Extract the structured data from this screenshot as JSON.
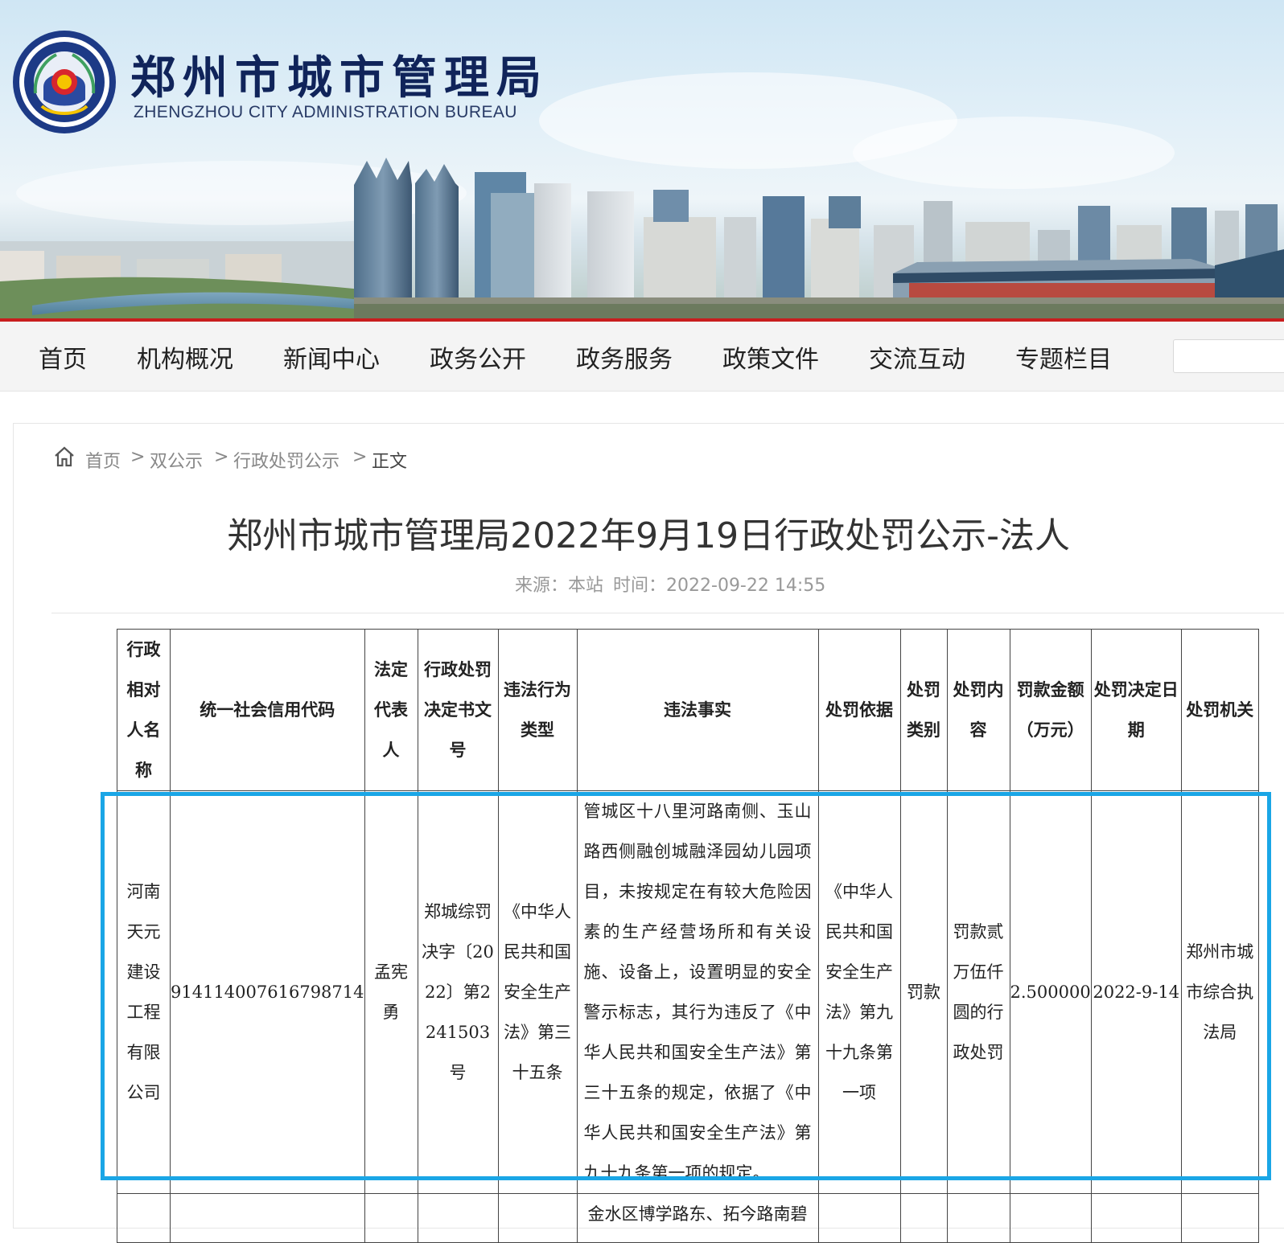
{
  "header": {
    "title": "郑州市城市管理局",
    "subtitle": "ZHENGZHOU CITY ADMINISTRATION BUREAU"
  },
  "nav": {
    "items": [
      "首页",
      "机构概况",
      "新闻中心",
      "政务公开",
      "政务服务",
      "政策文件",
      "交流互动",
      "专题栏目"
    ],
    "search_placeholder": ""
  },
  "breadcrumb": {
    "items": [
      "首页",
      "双公示",
      "行政处罚公示",
      "正文"
    ],
    "separator": ">"
  },
  "article": {
    "title": "郑州市城市管理局2022年9月19日行政处罚公示-法人",
    "source": "来源：本站",
    "time": "时间：2022-09-22 14:55"
  },
  "table": {
    "headers": [
      "行政相对人名称",
      "统一社会信用代码",
      "法定代表人",
      "行政处罚决定书文号",
      "违法行为类型",
      "违法事实",
      "处罚依据",
      "处罚类别",
      "处罚内容",
      "罚款金额（万元）",
      "处罚决定日期",
      "处罚机关"
    ],
    "rows": [
      {
        "name": "河南天元建设工程有限公司",
        "credit_code": "914114007616798714",
        "legal_rep": "孟宪勇",
        "doc_no": "郑城综罚决字〔2022〕第2241503号",
        "violation_type": "《中华人民共和国安全生产法》第三十五条",
        "facts": "管城区十八里河路南侧、玉山路西侧融创城融泽园幼儿园项目，未按规定在有较大危险因素的生产经营场所和有关设施、设备上，设置明显的安全警示标志，其行为违反了《中华人民共和国安全生产法》第三十五条的规定，依据了《中华人民共和国安全生产法》第九十九条第一项的规定。",
        "basis": "《中华人民共和国安全生产法》第九十九条第一项",
        "category": "罚款",
        "content": "罚款贰万伍仟圆的行政处罚",
        "amount": "2.500000",
        "date": "2022-9-14",
        "authority": "郑州市城市综合执法局"
      }
    ],
    "next_row_partial": "金水区博学路东、拓今路南碧"
  },
  "colors": {
    "title_blue": "#10245a",
    "accent_red": "#c81e1e",
    "highlight": "#1aa6e6"
  },
  "icons": {
    "breadcrumb_home": "home-icon",
    "emblem": "emblem-icon"
  }
}
